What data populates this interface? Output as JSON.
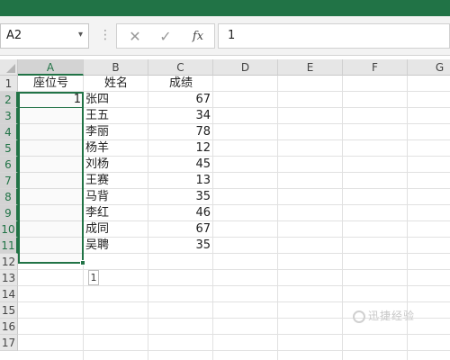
{
  "formula_bar": {
    "name_box": "A2",
    "name_box_arrow": "▾",
    "grip": "⋮",
    "cancel_glyph": "✕",
    "enter_glyph": "✓",
    "fx_label": "fx",
    "formula_value": "1"
  },
  "columns": [
    "A",
    "B",
    "C",
    "D",
    "E",
    "F",
    "G"
  ],
  "rows": [
    "1",
    "2",
    "3",
    "4",
    "5",
    "6",
    "7",
    "8",
    "9",
    "10",
    "11",
    "12",
    "13",
    "14",
    "15",
    "16",
    "17"
  ],
  "headers": {
    "A": "座位号",
    "B": "姓名",
    "C": "成绩"
  },
  "data_rows": [
    {
      "seat": "1",
      "name": "张四",
      "score": "67"
    },
    {
      "seat": "",
      "name": "王五",
      "score": "34"
    },
    {
      "seat": "",
      "name": "李丽",
      "score": "78"
    },
    {
      "seat": "",
      "name": "杨羊",
      "score": "12"
    },
    {
      "seat": "",
      "name": "刘杨",
      "score": "45"
    },
    {
      "seat": "",
      "name": "王赛",
      "score": "13"
    },
    {
      "seat": "",
      "name": "马背",
      "score": "35"
    },
    {
      "seat": "",
      "name": "李红",
      "score": "46"
    },
    {
      "seat": "",
      "name": "成同",
      "score": "67"
    },
    {
      "seat": "",
      "name": "吴聘",
      "score": "35"
    }
  ],
  "autofill_options_label": "1",
  "watermark": "迅捷经验",
  "colors": {
    "accent": "#217346",
    "header_bg": "#e6e6e6",
    "gridline": "#e1e1e1"
  }
}
